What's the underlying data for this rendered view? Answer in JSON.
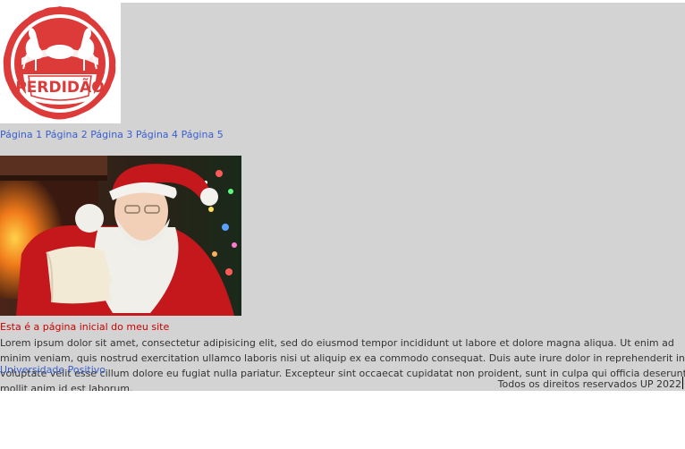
{
  "logo": {
    "wordmark": "PERDIDÃO",
    "icon": "turkey-seal-icon"
  },
  "nav": {
    "items": [
      {
        "label": "Página 1"
      },
      {
        "label": "Página 2"
      },
      {
        "label": "Página 3"
      },
      {
        "label": "Página 4"
      },
      {
        "label": "Página 5"
      }
    ]
  },
  "hero": {
    "subject": "santa-claus-photo"
  },
  "main": {
    "headline": "Esta é a página inicial do meu site",
    "paragraph": "Lorem ipsum dolor sit amet, consectetur adipisicing elit, sed do eiusmod tempor incididunt ut labore et dolore magna aliqua. Ut enim ad minim veniam, quis nostrud exercitation ullamco laboris nisi ut aliquip ex ea commodo consequat. Duis aute irure dolor in reprehenderit in voluptate velit esse cillum dolore eu fugiat nulla pariatur. Excepteur sint occaecat cupidatat non proident, sunt in culpa qui officia deserunt mollit anim id est laborum.",
    "link": "Universidade Positivo"
  },
  "footer": {
    "copyright": "Todos os direitos reservados UP 2022"
  },
  "colors": {
    "page_bg": "#d3d3d3",
    "link": "#3a5fcd",
    "headline": "#cc0000",
    "brand_red": "#dd3a3a"
  }
}
